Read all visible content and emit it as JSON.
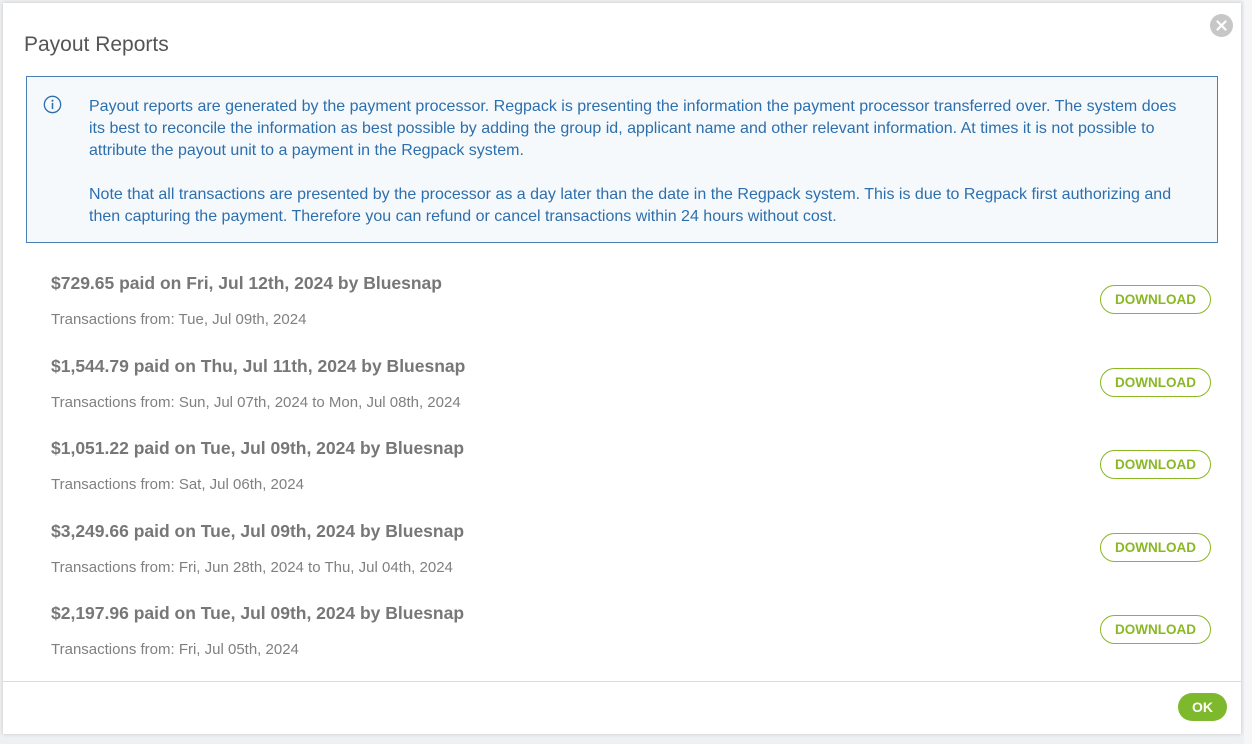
{
  "modal": {
    "title": "Payout Reports",
    "close_icon": "close-icon"
  },
  "info": {
    "icon": "info-icon",
    "paragraph1": "Payout reports are generated by the payment processor. Regpack is presenting the information the payment processor transferred over. The system does its best to reconcile the information as best possible by adding the group id, applicant name and other relevant information. At times it is not possible to attribute the payout unit to a payment in the Regpack system.",
    "paragraph2": "Note that all transactions are presented by the processor as a day later than the date in the Regpack system. This is due to Regpack first authorizing and then capturing the payment. Therefore you can refund or cancel transactions within 24 hours without cost."
  },
  "payouts": [
    {
      "title": "$729.65 paid on Fri, Jul 12th, 2024 by Bluesnap",
      "range": "Transactions from: Tue, Jul 09th, 2024",
      "button": "DOWNLOAD"
    },
    {
      "title": "$1,544.79 paid on Thu, Jul 11th, 2024 by Bluesnap",
      "range": "Transactions from: Sun, Jul 07th, 2024 to Mon, Jul 08th, 2024",
      "button": "DOWNLOAD"
    },
    {
      "title": "$1,051.22 paid on Tue, Jul 09th, 2024 by Bluesnap",
      "range": "Transactions from: Sat, Jul 06th, 2024",
      "button": "DOWNLOAD"
    },
    {
      "title": "$3,249.66 paid on Tue, Jul 09th, 2024 by Bluesnap",
      "range": "Transactions from: Fri, Jun 28th, 2024 to Thu, Jul 04th, 2024",
      "button": "DOWNLOAD"
    },
    {
      "title": "$2,197.96 paid on Tue, Jul 09th, 2024 by Bluesnap",
      "range": "Transactions from: Fri, Jul 05th, 2024",
      "button": "DOWNLOAD"
    }
  ],
  "footer": {
    "ok_label": "OK"
  },
  "colors": {
    "accent_green": "#8ab825",
    "ok_green": "#7db82d",
    "info_blue": "#2d6fad",
    "info_border": "#4a7fb5"
  }
}
